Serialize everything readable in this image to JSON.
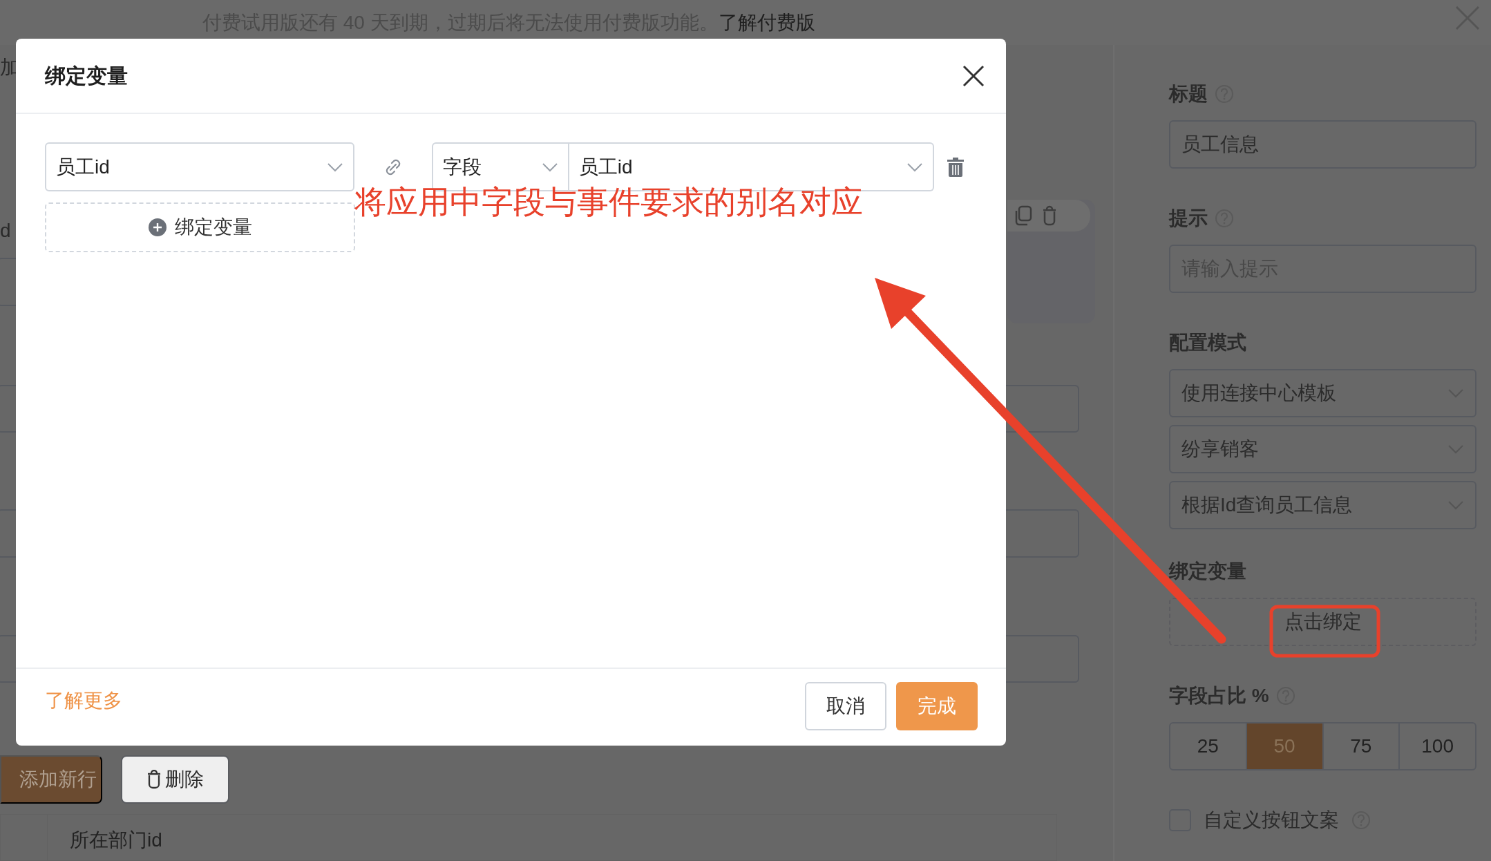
{
  "banner": {
    "text": "付费试用版还有 40 天到期，过期后将无法使用付费版功能。",
    "link": "了解付费版"
  },
  "background": {
    "top_text": "加",
    "side_text": "d",
    "bottom_buttons": [
      {
        "label": "添加新行",
        "kind": "primary"
      },
      {
        "label": "删除",
        "kind": "delete"
      }
    ],
    "table_header": "所在部门id"
  },
  "side_panel": {
    "fields": [
      {
        "kind": "input",
        "label": "标题",
        "help": true,
        "value": "员工信息"
      },
      {
        "kind": "input",
        "label": "提示",
        "help": true,
        "placeholder": "请输入提示"
      },
      {
        "kind": "selects",
        "label": "配置模式",
        "help": false,
        "values": [
          "使用连接中心模板",
          "纷享销客",
          "根据Id查询员工信息"
        ]
      },
      {
        "kind": "bind",
        "label": "绑定变量",
        "help": false,
        "button": "点击绑定"
      },
      {
        "kind": "segments",
        "label": "字段占比 %",
        "help": true,
        "options": [
          {
            "label": "25",
            "selected": false
          },
          {
            "label": "50",
            "selected": true
          },
          {
            "label": "75",
            "selected": false
          },
          {
            "label": "100",
            "selected": false
          }
        ]
      },
      {
        "kind": "checkbox",
        "label": "自定义按钮文案",
        "help": true,
        "checked": false
      }
    ]
  },
  "dialog": {
    "title": "绑定变量",
    "bindings": [
      {
        "variable": "员工id",
        "source_type": "字段",
        "field": "员工id"
      }
    ],
    "add_button": "绑定变量",
    "footer_link": "了解更多",
    "buttons": [
      {
        "label": "取消",
        "kind": "default"
      },
      {
        "label": "完成",
        "kind": "primary"
      }
    ]
  },
  "annotation": {
    "text": "将应用中字段与事件要求的别名对应"
  }
}
